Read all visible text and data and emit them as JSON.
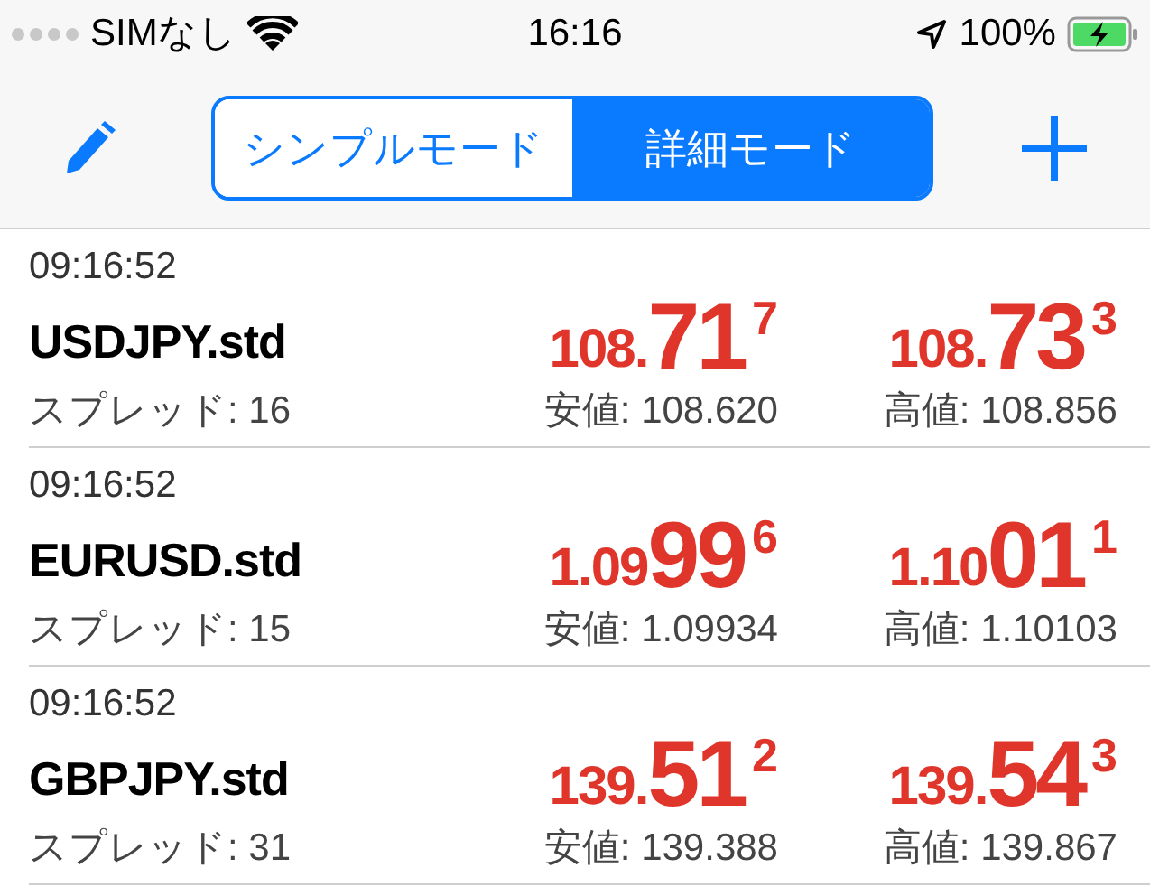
{
  "status_bar": {
    "carrier": "SIMなし",
    "time": "16:16",
    "battery": "100%"
  },
  "mode_tabs": [
    {
      "label": "シンプルモード",
      "selected": false
    },
    {
      "label": "詳細モード",
      "selected": true
    }
  ],
  "quotes": [
    {
      "time": "09:16:52",
      "symbol": "USDJPY.std",
      "spread": "スプレッド: 16",
      "bid": {
        "prefix": "108.",
        "big": "71",
        "pip": "7"
      },
      "ask": {
        "prefix": "108.",
        "big": "73",
        "pip": "3"
      },
      "low": "安値: 108.620",
      "high": "高値: 108.856"
    },
    {
      "time": "09:16:52",
      "symbol": "EURUSD.std",
      "spread": "スプレッド: 15",
      "bid": {
        "prefix": "1.09",
        "big": "99",
        "pip": "6"
      },
      "ask": {
        "prefix": "1.10",
        "big": "01",
        "pip": "1"
      },
      "low": "安値: 1.09934",
      "high": "高値: 1.10103"
    },
    {
      "time": "09:16:52",
      "symbol": "GBPJPY.std",
      "spread": "スプレッド: 31",
      "bid": {
        "prefix": "139.",
        "big": "51",
        "pip": "2"
      },
      "ask": {
        "prefix": "139.",
        "big": "54",
        "pip": "3"
      },
      "low": "安値: 139.388",
      "high": "高値: 139.867"
    }
  ]
}
